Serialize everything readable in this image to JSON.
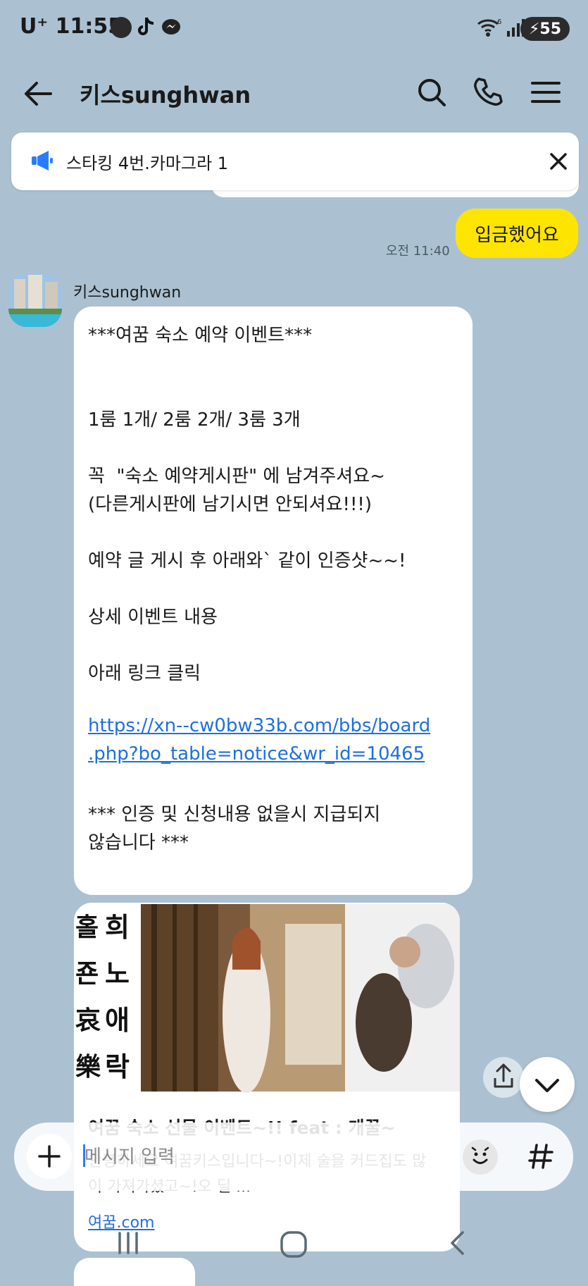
{
  "status_bar": {
    "carrier": "U⁺",
    "time": "11:55",
    "battery": "55",
    "wifi_label": "6"
  },
  "header": {
    "title": "키스sunghwan"
  },
  "notice": {
    "text": "스타킹 4번.카마그라 1"
  },
  "my_message": {
    "text": "입금했어요",
    "time": "오전 11:40",
    "bubble_color": "#fee500"
  },
  "sender": {
    "name": "키스sunghwan"
  },
  "message_lines": [
    "***여꿈 숙소 예약 이벤트***",
    "",
    "",
    "1룸 1개/ 2룸 2개/ 3룸 3개",
    "",
    "꼭  \"숙소 예약게시판\" 에 남겨주셔요~",
    "(다른게시판에 남기시면 안되셔요!!!)",
    "",
    "예약 글 게시 후 아래와` 같이 인증샷~~!",
    "",
    "상세 이벤트 내용",
    "",
    "아래 링크 클릭",
    ""
  ],
  "message_link": {
    "line1": "https://xn--cw0bw33b.com/bbs/board",
    "line2": ".php?bo_table=notice&wr_id=10465"
  },
  "message_footer": {
    "line1": "*** 인증 및 신청내용 없을시 지급되지",
    "line2": "않습니다 ***"
  },
  "link_card": {
    "image_text_col1": [
      "홀",
      "죤",
      "哀",
      "樂"
    ],
    "image_text_col2": [
      "희",
      "노",
      "애",
      "락"
    ],
    "title": "여꿈 숙소 선물 이벤트~!! feat : 개꿀~",
    "description": "안녕하세요 여꿈키스입니다~!이제 술을 커드집도 많이 가져가셨고~!오 딜 ...",
    "url": "여꿈.com"
  },
  "input": {
    "placeholder": "메시지 입력"
  },
  "colors": {
    "chat_bg": "#abc1d1",
    "link": "#1e6fdc",
    "notice_icon": "#2a7cff"
  }
}
